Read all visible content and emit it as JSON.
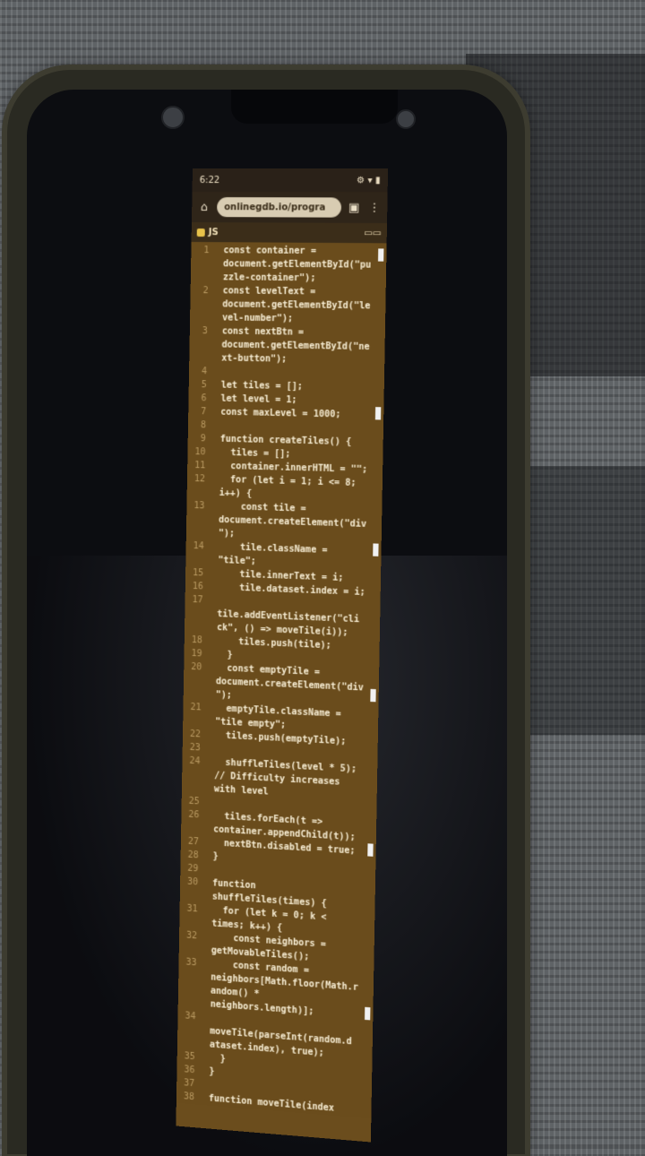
{
  "status_bar": {
    "time": "6:22",
    "icons": "⚙ ▾ ▮"
  },
  "browser": {
    "url": "onlinegdb.io/progra"
  },
  "editor": {
    "tab_label": "JS",
    "lines": [
      {
        "n": "1",
        "t": "  const container ="
      },
      {
        "n": "",
        "t": "  document.getElementById(\"pu"
      },
      {
        "n": "",
        "t": "  zzle-container\");"
      },
      {
        "n": "2",
        "t": "  const levelText ="
      },
      {
        "n": "",
        "t": "  document.getElementById(\"le"
      },
      {
        "n": "",
        "t": "  vel-number\");"
      },
      {
        "n": "3",
        "t": "  const nextBtn ="
      },
      {
        "n": "",
        "t": "  document.getElementById(\"ne"
      },
      {
        "n": "",
        "t": "  xt-button\");"
      },
      {
        "n": "4",
        "t": ""
      },
      {
        "n": "5",
        "t": "  let tiles = [];"
      },
      {
        "n": "6",
        "t": "  let level = 1;"
      },
      {
        "n": "7",
        "t": "  const maxLevel = 1000;"
      },
      {
        "n": "8",
        "t": ""
      },
      {
        "n": "9",
        "t": "  function createTiles() {"
      },
      {
        "n": "10",
        "t": "    tiles = [];"
      },
      {
        "n": "11",
        "t": "    container.innerHTML = \"\";"
      },
      {
        "n": "12",
        "t": "    for (let i = 1; i <= 8;"
      },
      {
        "n": "",
        "t": "  i++) {"
      },
      {
        "n": "13",
        "t": "      const tile ="
      },
      {
        "n": "",
        "t": "  document.createElement(\"div"
      },
      {
        "n": "",
        "t": "  \");"
      },
      {
        "n": "14",
        "t": "      tile.className ="
      },
      {
        "n": "",
        "t": "  \"tile\";"
      },
      {
        "n": "15",
        "t": "      tile.innerText = i;"
      },
      {
        "n": "16",
        "t": "      tile.dataset.index = i;"
      },
      {
        "n": "17",
        "t": ""
      },
      {
        "n": "",
        "t": "  tile.addEventListener(\"cli"
      },
      {
        "n": "",
        "t": "  ck\", () => moveTile(i));"
      },
      {
        "n": "18",
        "t": "      tiles.push(tile);"
      },
      {
        "n": "19",
        "t": "    }"
      },
      {
        "n": "20",
        "t": "    const emptyTile ="
      },
      {
        "n": "",
        "t": "  document.createElement(\"div"
      },
      {
        "n": "",
        "t": "  \");"
      },
      {
        "n": "21",
        "t": "    emptyTile.className ="
      },
      {
        "n": "",
        "t": "  \"tile empty\";"
      },
      {
        "n": "22",
        "t": "    tiles.push(emptyTile);"
      },
      {
        "n": "23",
        "t": ""
      },
      {
        "n": "24",
        "t": "    shuffleTiles(level * 5);"
      },
      {
        "n": "",
        "t": "  // Difficulty increases"
      },
      {
        "n": "",
        "t": "  with level"
      },
      {
        "n": "25",
        "t": ""
      },
      {
        "n": "26",
        "t": "    tiles.forEach(t =>"
      },
      {
        "n": "",
        "t": "  container.appendChild(t));"
      },
      {
        "n": "27",
        "t": "    nextBtn.disabled = true;"
      },
      {
        "n": "28",
        "t": "  }"
      },
      {
        "n": "29",
        "t": ""
      },
      {
        "n": "30",
        "t": "  function"
      },
      {
        "n": "",
        "t": "  shuffleTiles(times) {"
      },
      {
        "n": "31",
        "t": "    for (let k = 0; k <"
      },
      {
        "n": "",
        "t": "  times; k++) {"
      },
      {
        "n": "32",
        "t": "      const neighbors ="
      },
      {
        "n": "",
        "t": "  getMovableTiles();"
      },
      {
        "n": "33",
        "t": "      const random ="
      },
      {
        "n": "",
        "t": "  neighbors[Math.floor(Math.r"
      },
      {
        "n": "",
        "t": "  andom() *"
      },
      {
        "n": "",
        "t": "  neighbors.length)];"
      },
      {
        "n": "34",
        "t": ""
      },
      {
        "n": "",
        "t": "  moveTile(parseInt(random.d"
      },
      {
        "n": "",
        "t": "  ataset.index), true);"
      },
      {
        "n": "35",
        "t": "    }"
      },
      {
        "n": "36",
        "t": "  }"
      },
      {
        "n": "37",
        "t": ""
      },
      {
        "n": "38",
        "t": "  function moveTile(index"
      }
    ]
  }
}
